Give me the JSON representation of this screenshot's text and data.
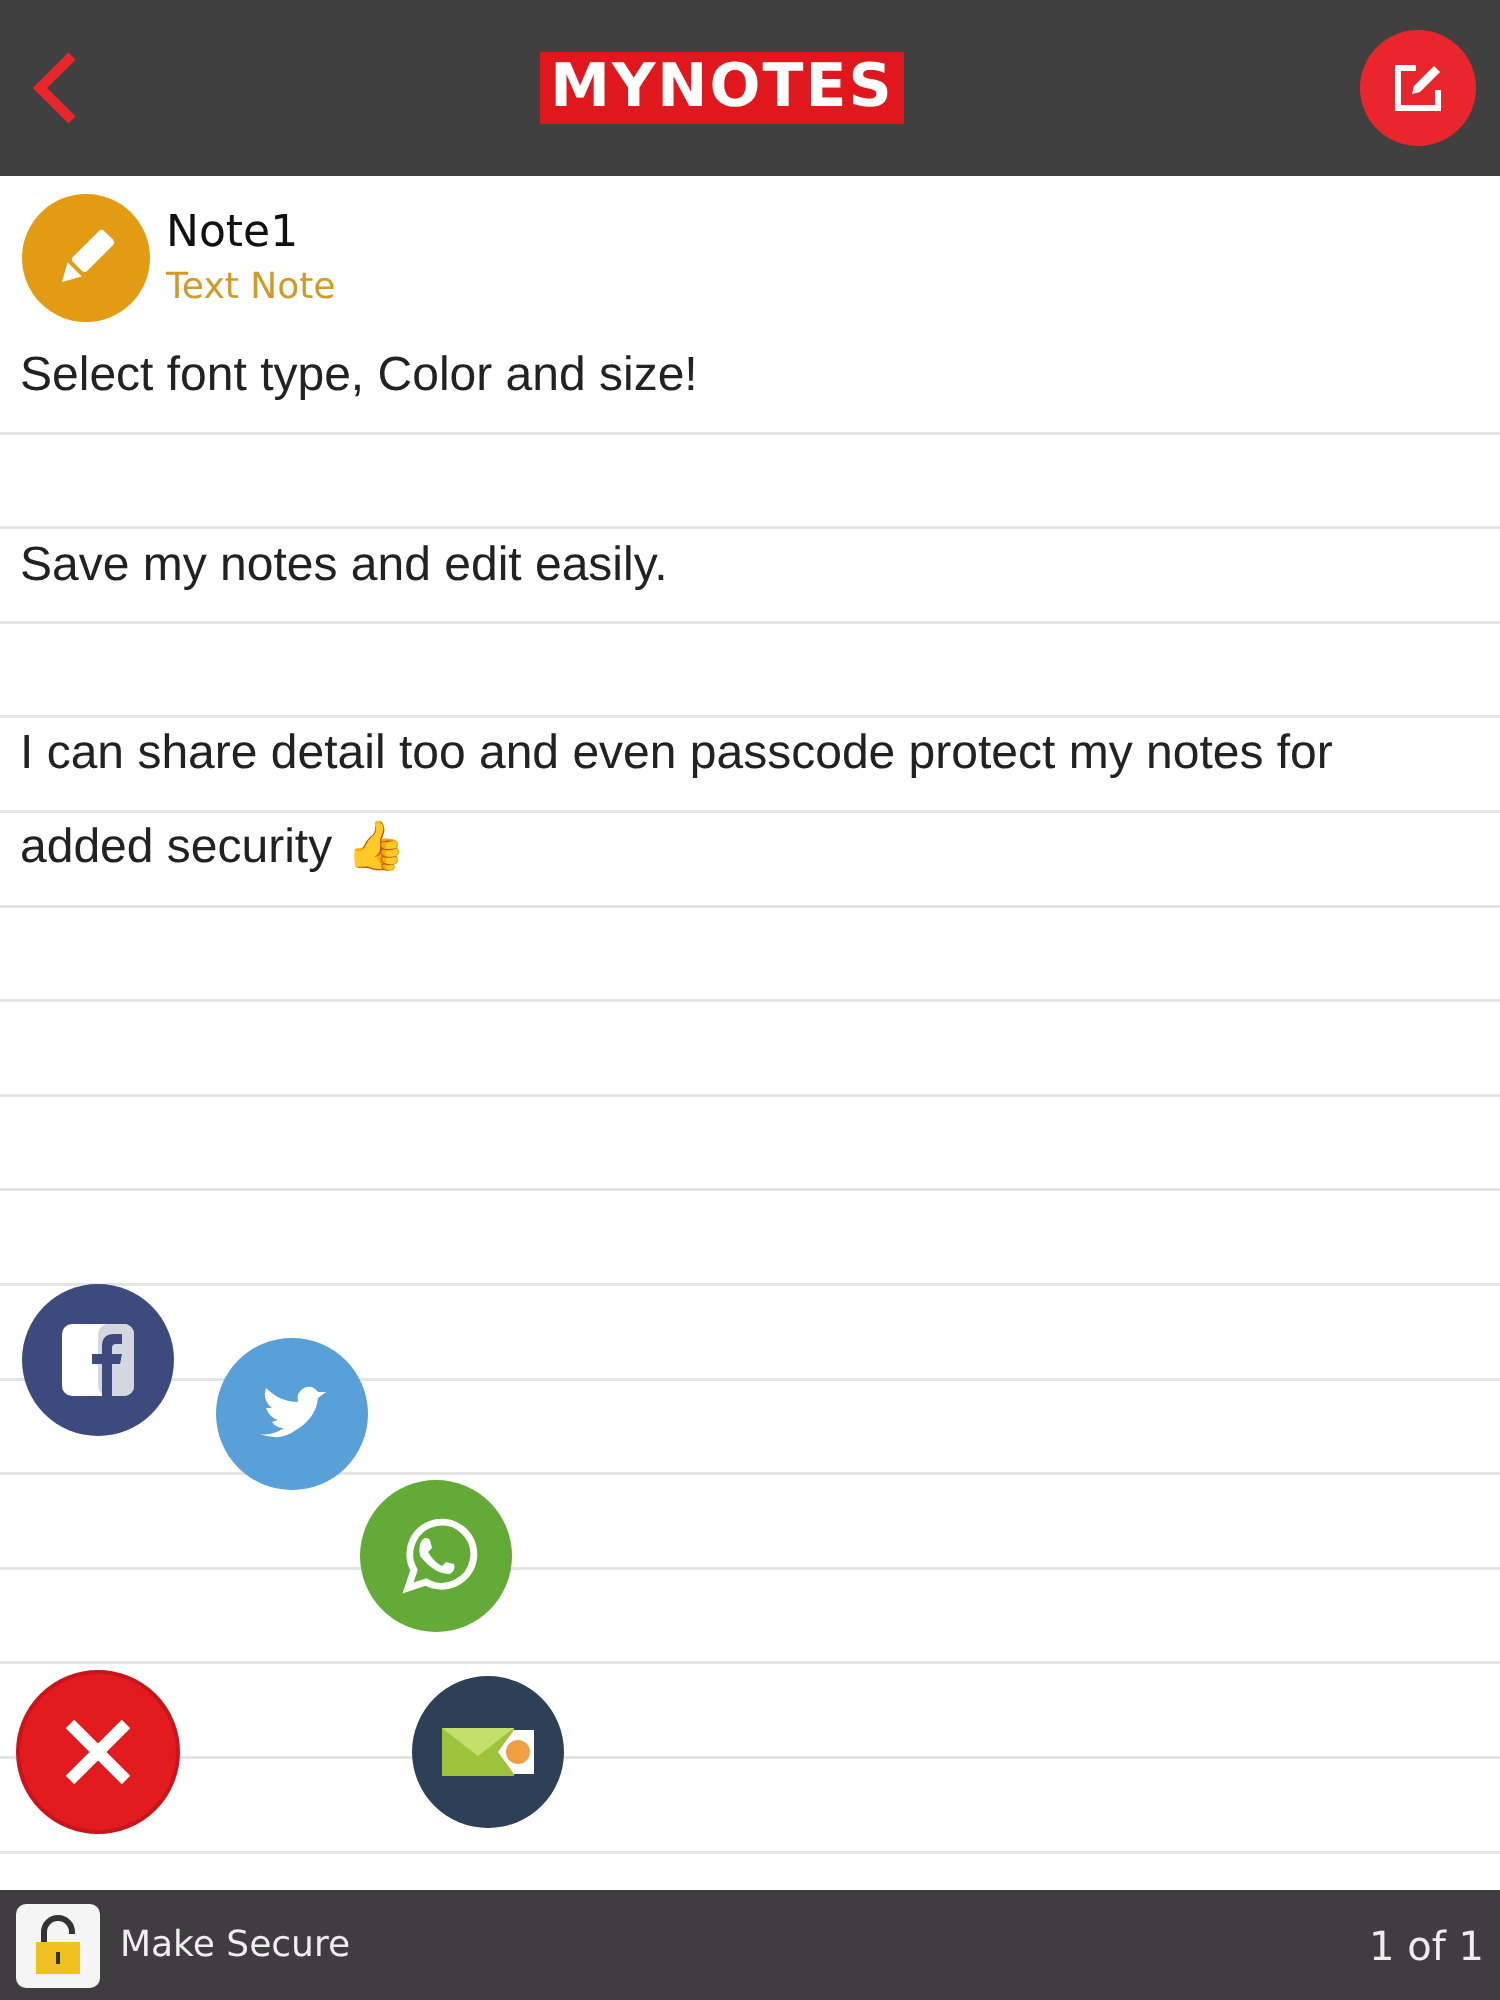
{
  "header": {
    "logo": "MYNOTES"
  },
  "note": {
    "title": "Note1",
    "type": "Text Note",
    "paragraphs": [
      "Select font type, Color and size!",
      "Save my notes and edit easily.",
      "I can share detail too and even passcode protect my notes for added security 👍"
    ]
  },
  "share_menu": {
    "items": [
      {
        "kind": "facebook"
      },
      {
        "kind": "twitter"
      },
      {
        "kind": "whatsapp"
      },
      {
        "kind": "close"
      },
      {
        "kind": "mail"
      }
    ]
  },
  "footer": {
    "secure_label": "Make Secure",
    "locked": false,
    "page": "1 of 1"
  }
}
